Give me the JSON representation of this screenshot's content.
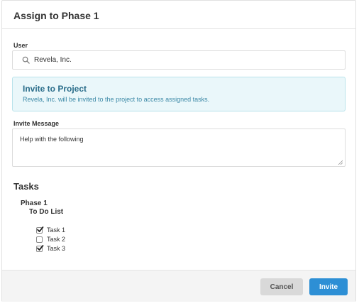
{
  "modal": {
    "title": "Assign to Phase 1"
  },
  "user_field": {
    "label": "User",
    "value": "Revela, Inc."
  },
  "invite_notice": {
    "title": "Invite to Project",
    "description": "Revela, Inc. will be invited to the project to access assigned tasks."
  },
  "message_field": {
    "label": "Invite Message",
    "value": "Help with the following"
  },
  "tasks": {
    "heading": "Tasks",
    "phase": "Phase 1",
    "list": "To Do List",
    "items": [
      {
        "label": "Task 1",
        "checked": true
      },
      {
        "label": "Task 2",
        "checked": false
      },
      {
        "label": "Task 3",
        "checked": true
      }
    ]
  },
  "footer": {
    "cancel_label": "Cancel",
    "invite_label": "Invite"
  },
  "colors": {
    "primary": "#2d8fd5",
    "notice_bg": "#eaf7fa",
    "notice_title": "#2a6d8a"
  },
  "icons": {
    "search": "search-icon",
    "check": "check-icon",
    "resize": "resize-handle-icon"
  }
}
